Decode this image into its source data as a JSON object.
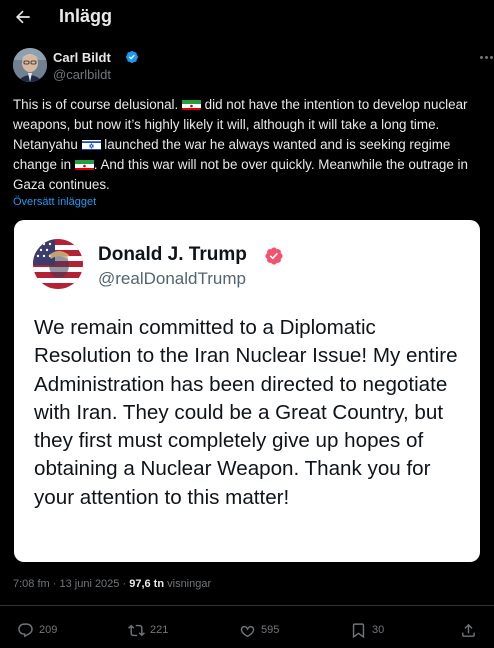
{
  "header": {
    "title": "Inlägg",
    "back_icon": "arrow-left-icon"
  },
  "author": {
    "name": "Carl Bildt",
    "handle": "@carlbildt",
    "verified_color": "#1d9bf0"
  },
  "tweet": {
    "seg1": "This is of course delusional. ",
    "seg2": " did not have the intention to develop nuclear weapons, but now it’s highly likely it will, although it will take a long time. Netanyahu ",
    "seg3": " launched the war he always wanted and is seeking regime change in ",
    "seg4": ". And this war will not be over quickly. Meanwhile the outrage in Gaza continues.",
    "flags": [
      "iran-flag-icon",
      "israel-flag-icon",
      "iran-flag-icon"
    ],
    "translate_label": "Översätt inlägget"
  },
  "quote": {
    "name": "Donald J. Trump",
    "handle": "@realDonaldTrump",
    "badge_color": "#f4516c",
    "text": "We remain committed to a Diplomatic Resolution to the Iran Nuclear Issue! My entire Administration has been directed to negotiate with Iran. They could be a Great Country, but they first must completely give up hopes of obtaining a Nuclear Weapon. Thank you for your attention to this matter!"
  },
  "meta": {
    "time": "7:08 fm",
    "date": "13 juni 2025",
    "views_count": "97,6 tn",
    "views_label": "visningar"
  },
  "actions": {
    "replies": "209",
    "reposts": "221",
    "likes": "595",
    "bookmarks": "30"
  },
  "colors": {
    "accent": "#1d9bf0",
    "background": "#000000",
    "muted": "#71767b"
  }
}
